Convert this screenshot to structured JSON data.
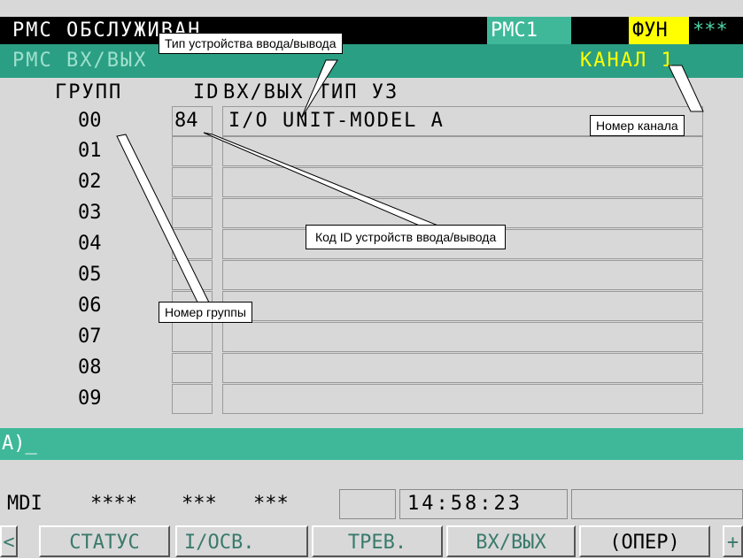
{
  "header": {
    "title": "РМС ОБСЛУЖИВАН",
    "pmc_label": "РМС1",
    "fun_label": "ФУН",
    "stars": "***",
    "subtitle": "РМС ВХ/ВЫХ",
    "channel": "КАНАЛ 1"
  },
  "table": {
    "col_group": "ГРУПП",
    "col_id": "ID",
    "col_type": "ВХ/ВЫХ ТИП УЗ",
    "rows": [
      {
        "group": "00",
        "id": "84",
        "type": "I/O UNIT-MODEL A"
      },
      {
        "group": "01",
        "id": "",
        "type": ""
      },
      {
        "group": "02",
        "id": "",
        "type": ""
      },
      {
        "group": "03",
        "id": "",
        "type": ""
      },
      {
        "group": "04",
        "id": "",
        "type": ""
      },
      {
        "group": "05",
        "id": "",
        "type": ""
      },
      {
        "group": "06",
        "id": "",
        "type": ""
      },
      {
        "group": "07",
        "id": "",
        "type": ""
      },
      {
        "group": "08",
        "id": "",
        "type": ""
      },
      {
        "group": "09",
        "id": "",
        "type": ""
      }
    ]
  },
  "input": {
    "prompt": "A)_"
  },
  "status": {
    "mode": "MDI",
    "s1": "****",
    "s2": "***",
    "s3": "***",
    "time": "14:58:23"
  },
  "softkeys": {
    "left_arrow": "<",
    "k1": "СТАТУС",
    "k2": "I/ОСВ.",
    "k3": "ТРЕВ.",
    "k4": "ВХ/ВЫХ",
    "k5": "(ОПЕР)",
    "right_plus": "+"
  },
  "callouts": {
    "type_label": "Тип устройства ввода/вывода",
    "channel_label": "Номер канала",
    "id_label": "Код ID устройств ввода/вывода",
    "group_label": "Номер группы"
  },
  "colors": {
    "accent_green": "#3fb89a",
    "subbar_green": "#2b9f83",
    "highlight_yellow": "#ffff00"
  }
}
